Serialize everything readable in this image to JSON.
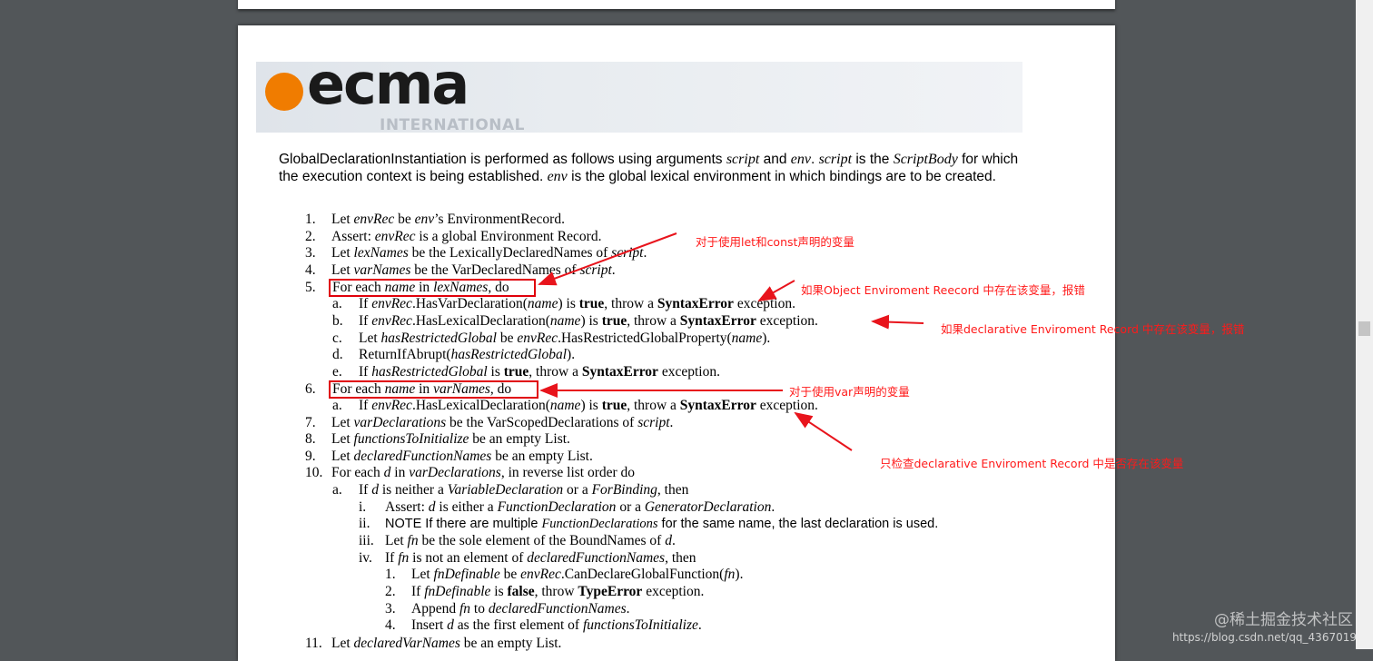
{
  "logo": {
    "word": "ecma",
    "sub": "INTERNATIONAL"
  },
  "intro": {
    "t1": "GlobalDeclarationInstantiation is performed as follows using arguments ",
    "script": "script",
    "and": " and ",
    "env": "env",
    "dot": ". ",
    "script2": "script",
    "isthe": " is the ",
    "scriptbody": "ScriptBody",
    "t2": " for which the execution context is being established. ",
    "env2": "env",
    "t3": " is the global lexical environment in which bindings are to be created."
  },
  "steps": {
    "s1": {
      "n": "1.",
      "html": "Let <i>envRec</i> be <i>env</i>’s EnvironmentRecord."
    },
    "s2": {
      "n": "2.",
      "html": "Assert: <i>envRec</i> is a global Environment Record."
    },
    "s3": {
      "n": "3.",
      "html": "Let <i>lexNames</i> be the LexicallyDeclaredNames of <i>script</i>."
    },
    "s4": {
      "n": "4.",
      "html": "Let <i>varNames</i> be the VarDeclaredNames of <i>script</i>."
    },
    "s5": {
      "n": "5.",
      "html": "For each <i>name</i> in <i>lexNames</i>, do"
    },
    "s5a": {
      "n": "a.",
      "html": "If <i>envRec</i>.HasVarDeclaration(<i>name</i>) is <b>true</b>, throw a <b>SyntaxError</b> exception."
    },
    "s5b": {
      "n": "b.",
      "html": "If <i>envRec</i>.HasLexicalDeclaration(<i>name</i>) is <b>true</b>, throw a <b>SyntaxError</b> exception."
    },
    "s5c": {
      "n": "c.",
      "html": "Let <i>hasRestrictedGlobal</i> be <i>envRec</i>.HasRestrictedGlobalProperty(<i>name</i>)."
    },
    "s5d": {
      "n": "d.",
      "html": "ReturnIfAbrupt(<i>hasRestrictedGlobal</i>)."
    },
    "s5e": {
      "n": "e.",
      "html": "If <i>hasRestrictedGlobal</i> is <b>true</b>, throw a <b>SyntaxError</b> exception."
    },
    "s6": {
      "n": "6.",
      "html": "For each <i>name</i> in <i>varNames</i>, do"
    },
    "s6a": {
      "n": "a.",
      "html": "If <i>envRec</i>.HasLexicalDeclaration(<i>name</i>) is <b>true</b>, throw a <b>SyntaxError</b> exception."
    },
    "s7": {
      "n": "7.",
      "html": "Let <i>varDeclarations</i> be the VarScopedDeclarations of <i>script</i>."
    },
    "s8": {
      "n": "8.",
      "html": "Let <i>functionsToInitialize</i> be an empty List."
    },
    "s9": {
      "n": "9.",
      "html": "Let <i>declaredFunctionNames</i> be an empty List."
    },
    "s10": {
      "n": "10.",
      "html": "For each <i>d</i> in <i>varDeclarations</i>, in reverse list order do"
    },
    "s10a": {
      "n": "a.",
      "html": "If <i>d</i> is neither a <i>VariableDeclaration</i> or a <i>ForBinding</i>, then"
    },
    "s10ai": {
      "n": "i.",
      "html": "Assert: <i>d</i> is either a <i>FunctionDeclaration</i> or a <i>GeneratorDeclaration</i>."
    },
    "s10aii": {
      "n": "ii.",
      "html": "NOTE If there are multiple <i>FunctionDeclarations</i> for the same name, the last declaration is used."
    },
    "s10aiii": {
      "n": "iii.",
      "html": "Let <i>fn</i> be the sole element of the BoundNames of <i>d</i>."
    },
    "s10aiv": {
      "n": "iv.",
      "html": "If <i>fn</i> is not an element of <i>declaredFunctionNames</i>, then"
    },
    "s10aiv1": {
      "n": "1.",
      "html": "Let <i>fnDefinable</i> be <i>envRec</i>.CanDeclareGlobalFunction(<i>fn</i>)."
    },
    "s10aiv2": {
      "n": "2.",
      "html": "If <i>fnDefinable</i> is <b>false</b>, throw <b>TypeError</b> exception."
    },
    "s10aiv3": {
      "n": "3.",
      "html": "Append <i>fn</i> to <i>declaredFunctionNames</i>."
    },
    "s10aiv4": {
      "n": "4.",
      "html": "Insert <i>d</i> as the first element of <i>functionsToInitialize</i>."
    },
    "s11": {
      "n": "11.",
      "html": "Let <i>declaredVarNames</i> be an empty List."
    }
  },
  "annotations": {
    "letconst": "对于使用let和const声明的变量",
    "objectEnv": "如果Object Enviroment Reecord 中存在该变量，报错",
    "declEnv": "如果declarative Enviroment Record 中存在该变量，报错",
    "varDecl": "对于使用var声明的变量",
    "onlyDecl": "只检查declarative Enviroment Record 中是否存在该变量"
  },
  "watermark": "@稀土掘金技术社区",
  "url": "https://blog.csdn.net/qq_4367019"
}
